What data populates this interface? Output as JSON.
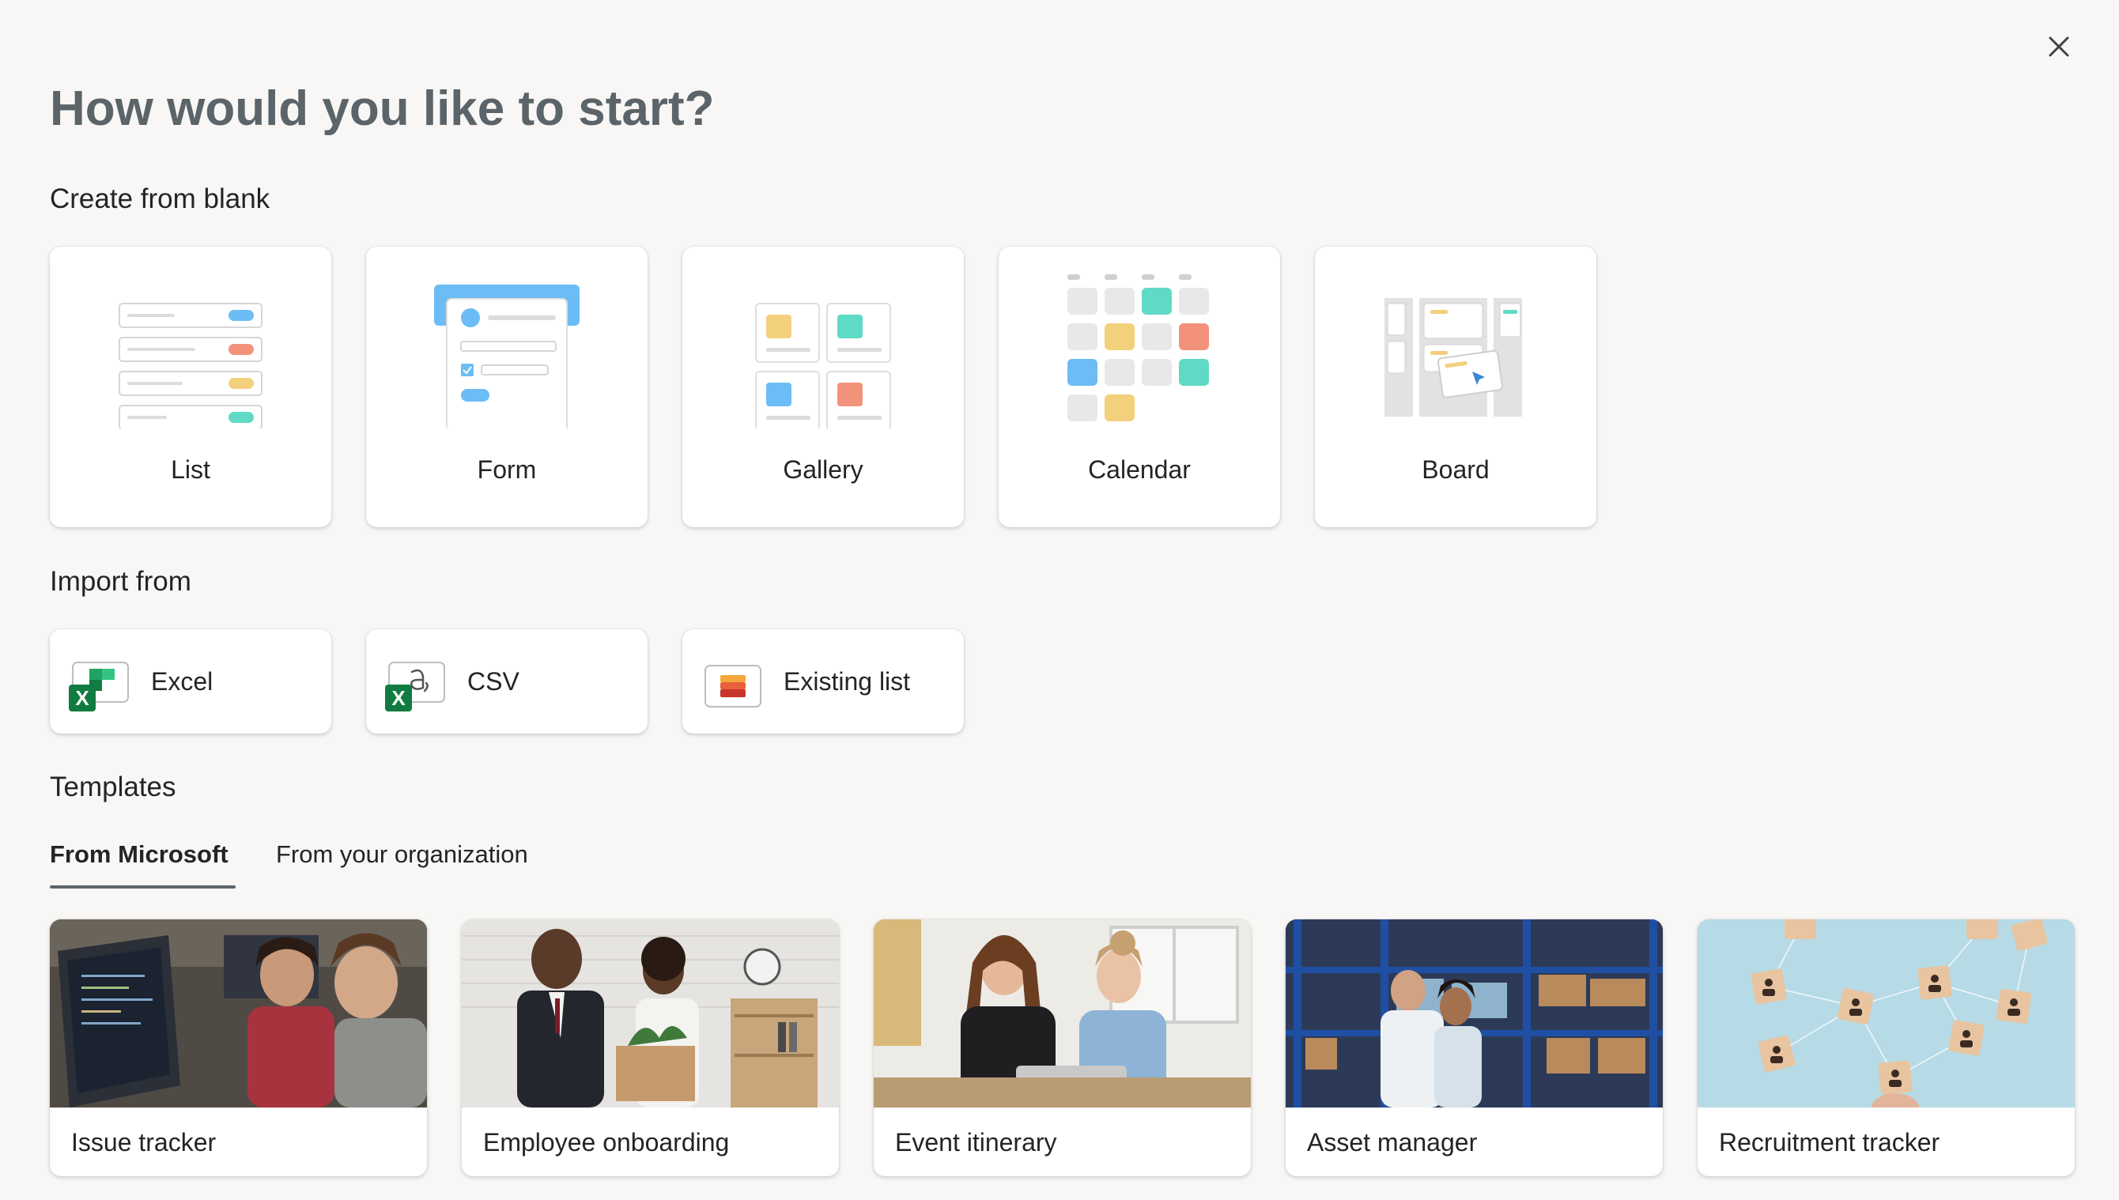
{
  "dialog": {
    "title": "How would you like to start?",
    "close_icon": "close-icon"
  },
  "blank": {
    "heading": "Create from blank",
    "items": [
      {
        "label": "List",
        "icon": "list-illustration"
      },
      {
        "label": "Form",
        "icon": "form-illustration"
      },
      {
        "label": "Gallery",
        "icon": "gallery-illustration"
      },
      {
        "label": "Calendar",
        "icon": "calendar-illustration"
      },
      {
        "label": "Board",
        "icon": "board-illustration"
      }
    ]
  },
  "import": {
    "heading": "Import from",
    "items": [
      {
        "label": "Excel",
        "icon": "excel-icon"
      },
      {
        "label": "CSV",
        "icon": "csv-icon"
      },
      {
        "label": "Existing list",
        "icon": "existing-list-icon"
      }
    ]
  },
  "templates": {
    "heading": "Templates",
    "tabs": [
      {
        "label": "From Microsoft",
        "selected": true
      },
      {
        "label": "From your organization",
        "selected": false
      }
    ],
    "items": [
      {
        "label": "Issue tracker"
      },
      {
        "label": "Employee onboarding"
      },
      {
        "label": "Event itinerary"
      },
      {
        "label": "Asset manager"
      },
      {
        "label": "Recruitment tracker"
      }
    ]
  },
  "colors": {
    "background": "#f8f7f5",
    "title": "#5b6469",
    "blue": "#6cbcf5",
    "red": "#f3927b",
    "yellow": "#f3d07c",
    "teal": "#5fdac4",
    "excel_green": "#107c41"
  }
}
